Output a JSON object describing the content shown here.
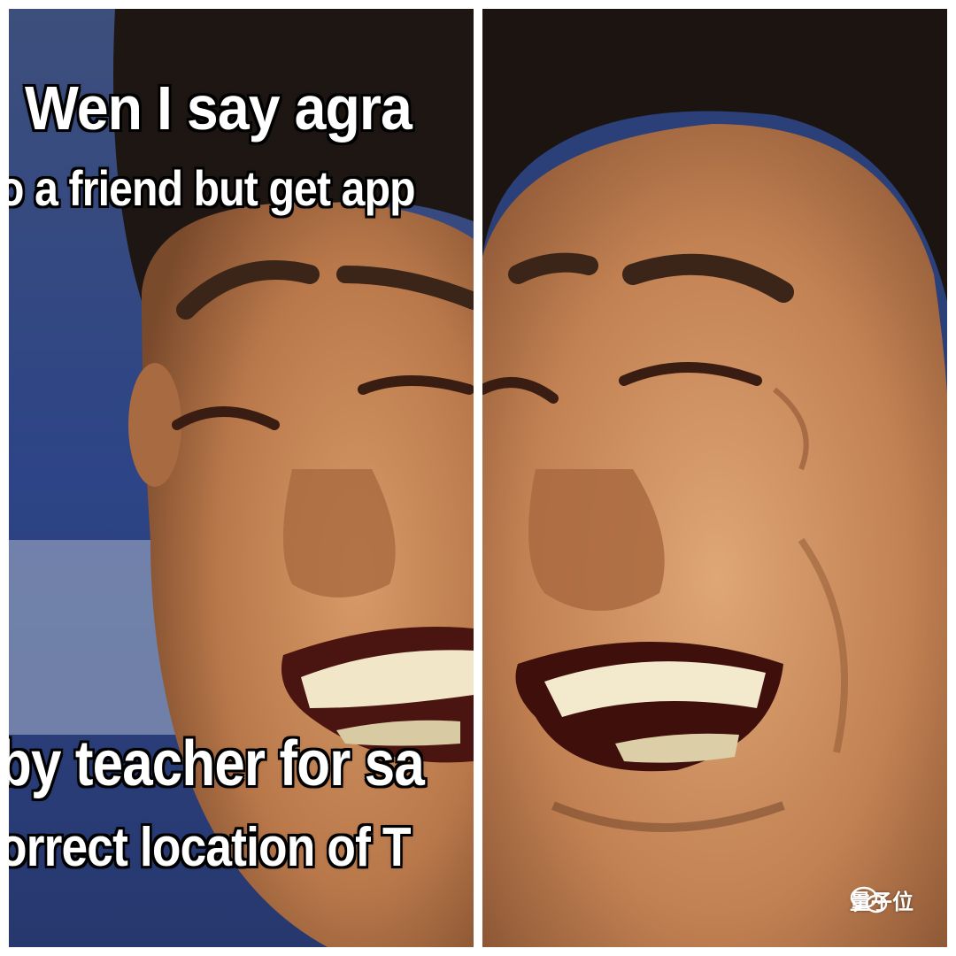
{
  "meme": {
    "left_panel": {
      "caption_lines": [
        "Wen I say agra",
        "o a friend but get app",
        "by teacher for sa",
        "orrect location of T"
      ]
    },
    "right_panel": {}
  },
  "watermark": {
    "icon": "wechat-icon",
    "text": "量子位"
  },
  "colors": {
    "background": "#ffffff",
    "skin": "#c98a5a",
    "backdrop_blue": "#2f4a86",
    "caption_fill": "#ffffff",
    "caption_outline": "#000000"
  }
}
